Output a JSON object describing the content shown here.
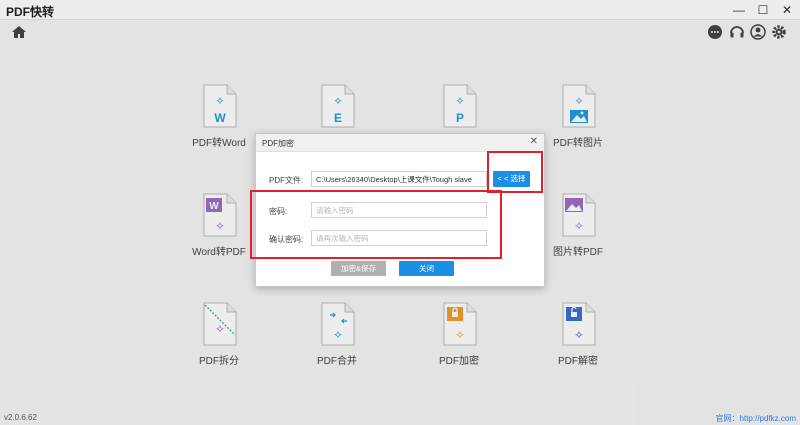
{
  "app": {
    "title": "PDF快转",
    "version": "v2.0.6.62",
    "website_label": "官网：",
    "website_url": "http://pdfkz.com"
  },
  "window_controls": {
    "minimize": "—",
    "maximize": "☐",
    "close": "✕"
  },
  "tools": [
    {
      "label": "PDF转Word",
      "letter": "W",
      "color": "#1e9de3"
    },
    {
      "label": "",
      "letter": "E",
      "color": "#1e9de3"
    },
    {
      "label": "",
      "letter": "P",
      "color": "#1e9de3"
    },
    {
      "label": "PDF转图片",
      "letter": "",
      "color": "#1e9de3"
    },
    {
      "label": "Word转PDF",
      "letter": "W",
      "color": "#9b6fc0"
    },
    {
      "label": "图片转PDF",
      "letter": "",
      "color": "#9b6fc0"
    },
    {
      "label": "PDF拆分",
      "letter": "",
      "color": "#9b6fc0"
    },
    {
      "label": "PDF合并",
      "letter": "",
      "color": "#1e9de3"
    },
    {
      "label": "PDF加密",
      "letter": "",
      "color": "#f39a2c"
    },
    {
      "label": "PDF解密",
      "letter": "",
      "color": "#3a6fd6"
    }
  ],
  "dialog": {
    "title": "PDF加密",
    "close": "✕",
    "file_label": "PDF文件:",
    "file_value": "C:\\Users\\26340\\Desktop\\上课文件\\Tough slave",
    "select_button": "< < 选择",
    "password_label": "密码:",
    "password_placeholder": "请输入密码",
    "confirm_label": "确认密码:",
    "confirm_placeholder": "请再次输入密码",
    "save_button": "加密&保存",
    "close_button": "关闭"
  },
  "colors": {
    "accent": "#1a8fe3",
    "highlight": "#e0212b",
    "disabled": "#b0b0b0"
  }
}
